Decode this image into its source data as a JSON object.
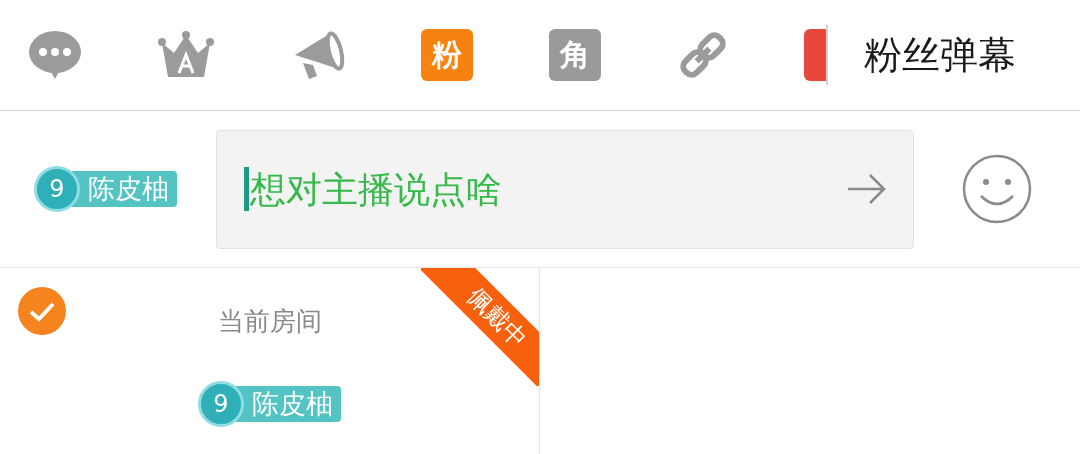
{
  "toolbar": {
    "items": [
      {
        "kind": "chat"
      },
      {
        "kind": "crown"
      },
      {
        "kind": "megaphone"
      },
      {
        "kind": "tag",
        "label": "粉",
        "color": "#f7820f"
      },
      {
        "kind": "tag",
        "label": "角",
        "color": "#9a9a9a"
      },
      {
        "kind": "link"
      },
      {
        "kind": "clipped",
        "color": "#e8483b"
      }
    ],
    "title": "粉丝弹幕"
  },
  "composer": {
    "badge": {
      "level": "9",
      "name": "陈皮柚"
    },
    "input": {
      "placeholder": "想对主播说点啥"
    }
  },
  "cards": [
    {
      "selected": true,
      "label": "当前房间",
      "ribbon": "佩戴中",
      "badge": {
        "level": "9",
        "name": "陈皮柚"
      }
    }
  ]
}
